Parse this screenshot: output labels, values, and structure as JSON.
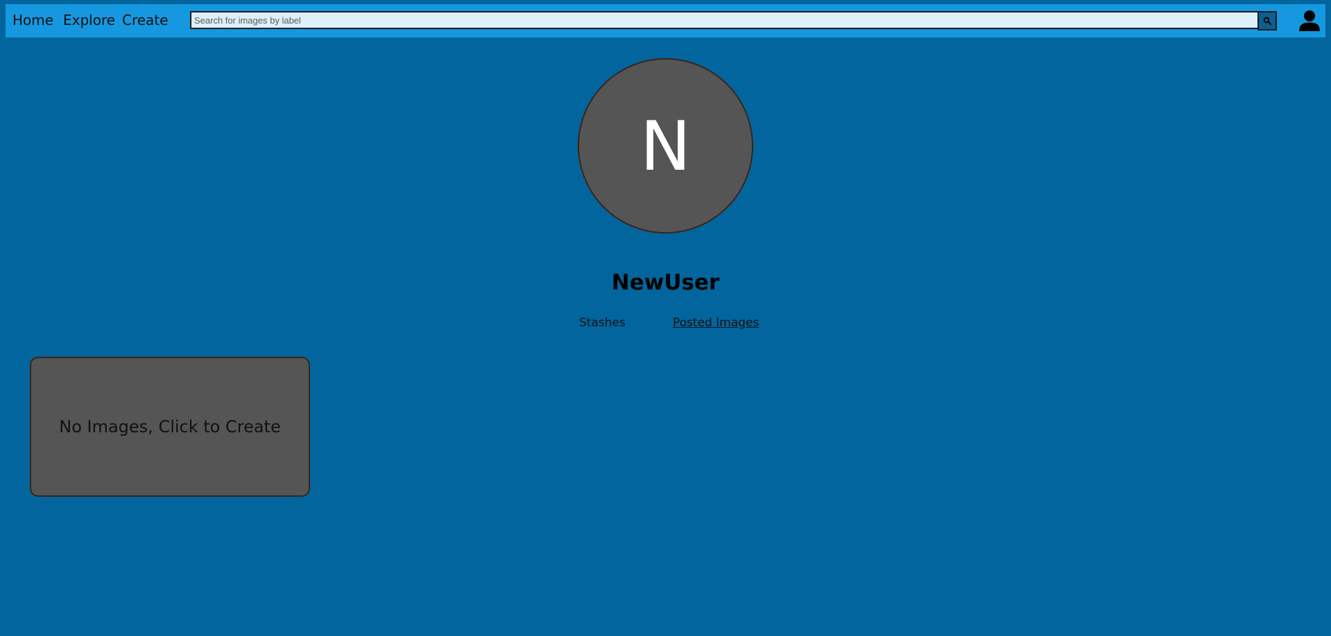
{
  "nav": {
    "home_label": "Home",
    "explore_label": "Explore",
    "create_label": "Create",
    "search_placeholder": "Search for images by label",
    "search_value": "",
    "search_icon": "search-icon",
    "user_icon": "user-icon"
  },
  "profile": {
    "avatar_letter": "N",
    "username": "NewUser",
    "tabs": [
      {
        "label": "Stashes",
        "active": false
      },
      {
        "label": "Posted Images",
        "active": true
      }
    ]
  },
  "gallery": {
    "empty_card_label": "No Images, Click to Create"
  },
  "colors": {
    "page_background": "#02659e",
    "navbar_background": "#1598df",
    "search_field_background": "#ddf0fc",
    "search_button_background": "#0c5f8f",
    "avatar_background": "#555555",
    "card_background": "#555555",
    "border_dark": "#3a2418"
  }
}
